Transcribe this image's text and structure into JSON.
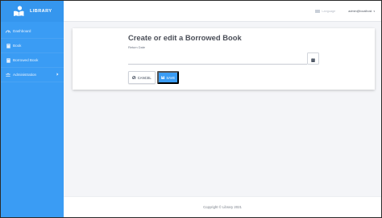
{
  "brand": {
    "name": "LIBRARY"
  },
  "sidebar": {
    "items": [
      {
        "label": "Dashboard",
        "icon": "dashboard-icon"
      },
      {
        "label": "Book",
        "icon": "book-icon"
      },
      {
        "label": "Borrowed Book",
        "icon": "book-icon"
      },
      {
        "label": "Administration",
        "icon": "users-icon",
        "has_submenu": true
      }
    ]
  },
  "topbar": {
    "language": "Language",
    "user_email": "admin@localhost"
  },
  "form": {
    "title": "Create or edit a Borrowed Book",
    "return_date_label": "Return Date",
    "return_date_value": "",
    "cancel_label": "CANCEL",
    "save_label": "SAVE"
  },
  "footer": {
    "text": "Copyright © Library 2021"
  },
  "colors": {
    "primary": "#3a9cf4",
    "background": "#f4f5f8"
  }
}
